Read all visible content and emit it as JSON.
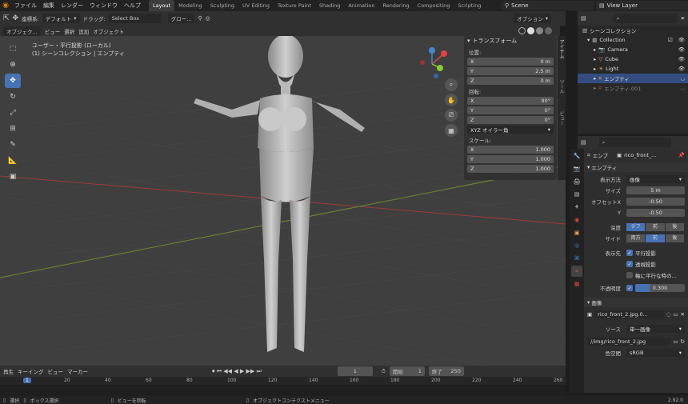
{
  "menu": {
    "items": [
      "ファイル",
      "編集",
      "レンダー",
      "ウィンドウ",
      "ヘルプ"
    ]
  },
  "workspaces": {
    "tabs": [
      "Layout",
      "Modeling",
      "Sculpting",
      "UV Editing",
      "Texture Paint",
      "Shading",
      "Animation",
      "Rendering",
      "Compositing",
      "Scripting"
    ],
    "active": "Layout"
  },
  "scene": {
    "label": "Scene"
  },
  "view_layer": {
    "label": "View Layer"
  },
  "header": {
    "mode": "座標系:",
    "orientation": "デフォルト",
    "drag_label": "ドラッグ:",
    "drag_value": "Select Box",
    "global": "グロー...",
    "options": "オプション"
  },
  "viewport_menu": {
    "items": [
      "オブジェク...",
      "ビュー",
      "選択",
      "追加",
      "オブジェクト"
    ]
  },
  "viewport_info": {
    "line1": "ユーザー・平行投影 (ローカル)",
    "line2": "(1) シーンコレクション | エンプティ"
  },
  "transform": {
    "title": "トランスフォーム",
    "location_label": "位置:",
    "location": [
      {
        "axis": "X",
        "value": "0 m"
      },
      {
        "axis": "Y",
        "value": "2.5 m"
      },
      {
        "axis": "Z",
        "value": "0 m"
      }
    ],
    "rotation_label": "回転:",
    "rotation": [
      {
        "axis": "X",
        "value": "90°"
      },
      {
        "axis": "Y",
        "value": "0°"
      },
      {
        "axis": "Z",
        "value": "0°"
      }
    ],
    "rotation_mode": "XYZ オイラー角",
    "scale_label": "スケール:",
    "scale": [
      {
        "axis": "X",
        "value": "1.000"
      },
      {
        "axis": "Y",
        "value": "1.000"
      },
      {
        "axis": "Z",
        "value": "1.000"
      }
    ]
  },
  "side_tabs": [
    "アイテム",
    "ツール",
    "ビュー"
  ],
  "outliner": {
    "title": "シーンコレクション",
    "rows": [
      {
        "name": "Collection",
        "indent": 1
      },
      {
        "name": "Camera",
        "indent": 2
      },
      {
        "name": "Cube",
        "indent": 2
      },
      {
        "name": "Light",
        "indent": 2
      },
      {
        "name": "エンプティ",
        "indent": 2,
        "selected": true
      },
      {
        "name": "エンプティ.001",
        "indent": 2
      }
    ]
  },
  "properties": {
    "object_name": "エンプ",
    "data_name": "rico_front_...",
    "section": "エンプティ",
    "display_label": "表示方法",
    "display_value": "画像",
    "size_label": "サイズ",
    "size_value": "5 m",
    "offset_x_label": "オフセットX",
    "offset_x_value": "-0.50",
    "offset_y_label": "Y",
    "offset_y_value": "-0.50",
    "depth_label": "深度",
    "depth_options": [
      "デフ",
      "前",
      "後"
    ],
    "side_label": "サイド",
    "side_options": [
      "両方",
      "前",
      "後"
    ],
    "show_label": "表示先",
    "show_options": [
      {
        "label": "平行投影",
        "checked": true
      },
      {
        "label": "透視投影",
        "checked": true
      },
      {
        "label": "軸に平行な時の...",
        "checked": false
      }
    ],
    "opacity_label": "不透明度",
    "opacity_value": "0.300",
    "image_section": "画像",
    "image_name": "rico_front_2.jpg.0...",
    "source_label": "ソース",
    "source_value": "単一画像",
    "filepath": "//img/rico_front_2.jpg",
    "colorspace_label": "色空間",
    "colorspace_value": "sRGB"
  },
  "timeline": {
    "menu": [
      "再生",
      "キーイング",
      "ビュー",
      "マーカー"
    ],
    "current_frame": "1",
    "start_label": "開始",
    "start": "1",
    "end_label": "終了",
    "end": "250",
    "ticks": [
      "1",
      "20",
      "40",
      "60",
      "80",
      "100",
      "120",
      "140",
      "160",
      "180",
      "200",
      "220",
      "240",
      "260"
    ]
  },
  "status": {
    "select": "選択",
    "box_select": "ボックス選択",
    "rotate_view": "ビューを回転",
    "context_menu": "オブジェクトコンテクストメニュー",
    "version": "2.92.0"
  },
  "colors": {
    "accent": "#4772b3",
    "viewport_bg": "#3f3f3f"
  }
}
